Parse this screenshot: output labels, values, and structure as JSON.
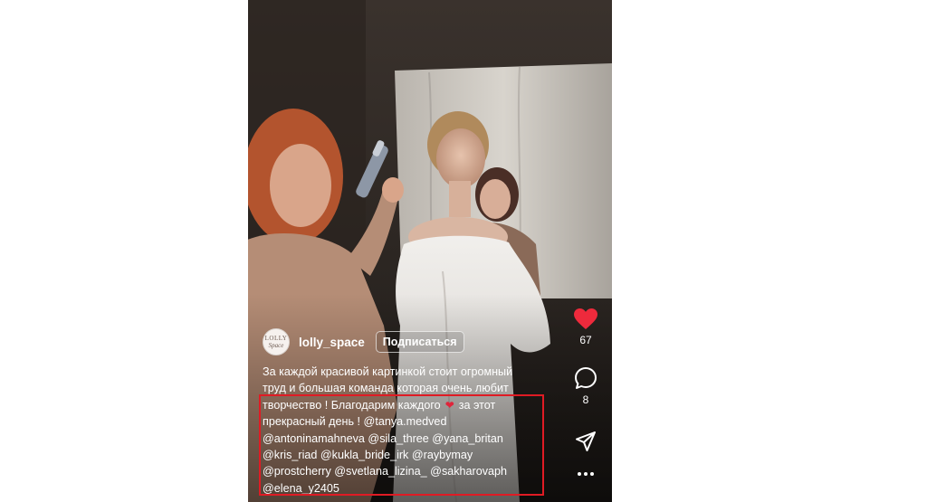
{
  "post": {
    "username": "lolly_space",
    "follow_label": "Подписаться",
    "avatar_text_1": "LOLLY",
    "avatar_text_2": "Space"
  },
  "caption": {
    "line1": "За каждой красивой картинкой стоит огромный",
    "line2": "труд и большая команда которая очень любит",
    "line3a": "творчество ! Благодарим каждого",
    "line3b": "за этот",
    "line4": "прекрасный день !  @tanya.medved",
    "line5": "@antoninamahneva @sila_three @yana_britan",
    "line6": "@kris_riad @kukla_bride_irk @raybymay",
    "line7": "@prostcherry @svetlana_lizina_ @sakharovaph",
    "line8": "@elena_y2405"
  },
  "actions": {
    "likes": "67",
    "comments": "8"
  },
  "colors": {
    "like": "#ee2a3c",
    "highlight": "#e01b24"
  },
  "icons": [
    "heart-icon",
    "comment-icon",
    "share-icon",
    "more-icon"
  ]
}
